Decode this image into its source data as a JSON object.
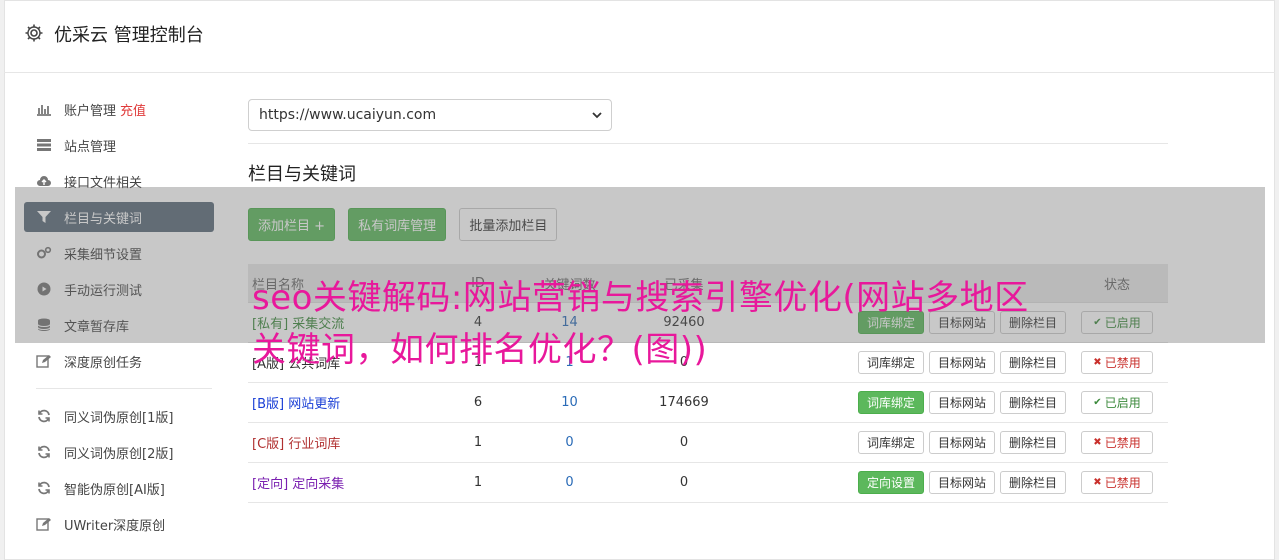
{
  "app": {
    "title": "优采云 管理控制台",
    "icon": "gear-icon"
  },
  "sidebar": {
    "items": [
      {
        "label": "账户管理",
        "badge": "充值",
        "icon": "bar-chart-icon",
        "active": false
      },
      {
        "label": "站点管理",
        "icon": "server-icon",
        "active": false
      },
      {
        "label": "接口文件相关",
        "icon": "cloud-upload-icon",
        "active": false
      },
      {
        "label": "栏目与关键词",
        "icon": "filter-icon",
        "active": true
      },
      {
        "label": "采集细节设置",
        "icon": "cogs-icon",
        "active": false
      },
      {
        "label": "手动运行测试",
        "icon": "play-icon",
        "active": false
      },
      {
        "label": "文章暂存库",
        "icon": "database-icon",
        "active": false
      },
      {
        "label": "深度原创任务",
        "icon": "edit-icon",
        "active": false
      }
    ],
    "items2": [
      {
        "label": "同义词伪原创[1版]",
        "icon": "refresh-icon"
      },
      {
        "label": "同义词伪原创[2版]",
        "icon": "refresh-icon"
      },
      {
        "label": "智能伪原创[AI版]",
        "icon": "refresh-icon"
      },
      {
        "label": "UWriter深度原创",
        "icon": "edit-icon"
      }
    ]
  },
  "site_select": {
    "value": "https://www.ucaiyun.com"
  },
  "section": {
    "title": "栏目与关键词"
  },
  "toolbar": {
    "add_column": "添加栏目 +",
    "private_lib": "私有词库管理",
    "batch_add": "批量添加栏目"
  },
  "table": {
    "headers": {
      "name": "栏目名称",
      "id": "ID",
      "count": "关键词数",
      "total": "已采集",
      "ops": "",
      "status": "状态"
    },
    "rows": [
      {
        "tag": "[私有]",
        "name": "采集交流",
        "tag_color": "#3c8a3c",
        "id": "4",
        "count": "14",
        "total": "92460",
        "bind": "词库绑定",
        "bind_style": "green",
        "target": "目标网站",
        "delete": "删除栏目",
        "status": "已启用",
        "enabled": true
      },
      {
        "tag": "[A版]",
        "name": "公共词库",
        "tag_color": "#333333",
        "id": "1",
        "count": "1",
        "total": "0",
        "bind": "词库绑定",
        "bind_style": "white",
        "target": "目标网站",
        "delete": "删除栏目",
        "status": "已禁用",
        "enabled": false
      },
      {
        "tag": "[B版]",
        "name": "网站更新",
        "tag_color": "#1a3fd6",
        "id": "6",
        "count": "10",
        "total": "174669",
        "bind": "词库绑定",
        "bind_style": "green",
        "target": "目标网站",
        "delete": "删除栏目",
        "status": "已启用",
        "enabled": true
      },
      {
        "tag": "[C版]",
        "name": "行业词库",
        "tag_color": "#b03030",
        "id": "1",
        "count": "0",
        "total": "0",
        "bind": "词库绑定",
        "bind_style": "white",
        "target": "目标网站",
        "delete": "删除栏目",
        "status": "已禁用",
        "enabled": false
      },
      {
        "tag": "[定向]",
        "name": "定向采集",
        "tag_color": "#7a1fb0",
        "id": "1",
        "count": "0",
        "total": "0",
        "bind": "定向设置",
        "bind_style": "green",
        "target": "目标网站",
        "delete": "删除栏目",
        "status": "已禁用",
        "enabled": false
      }
    ]
  },
  "overlay": {
    "headline": "seo关键解码:网站营销与搜索引擎优化(网站多地区关键词，如何排名优化？(图))"
  }
}
